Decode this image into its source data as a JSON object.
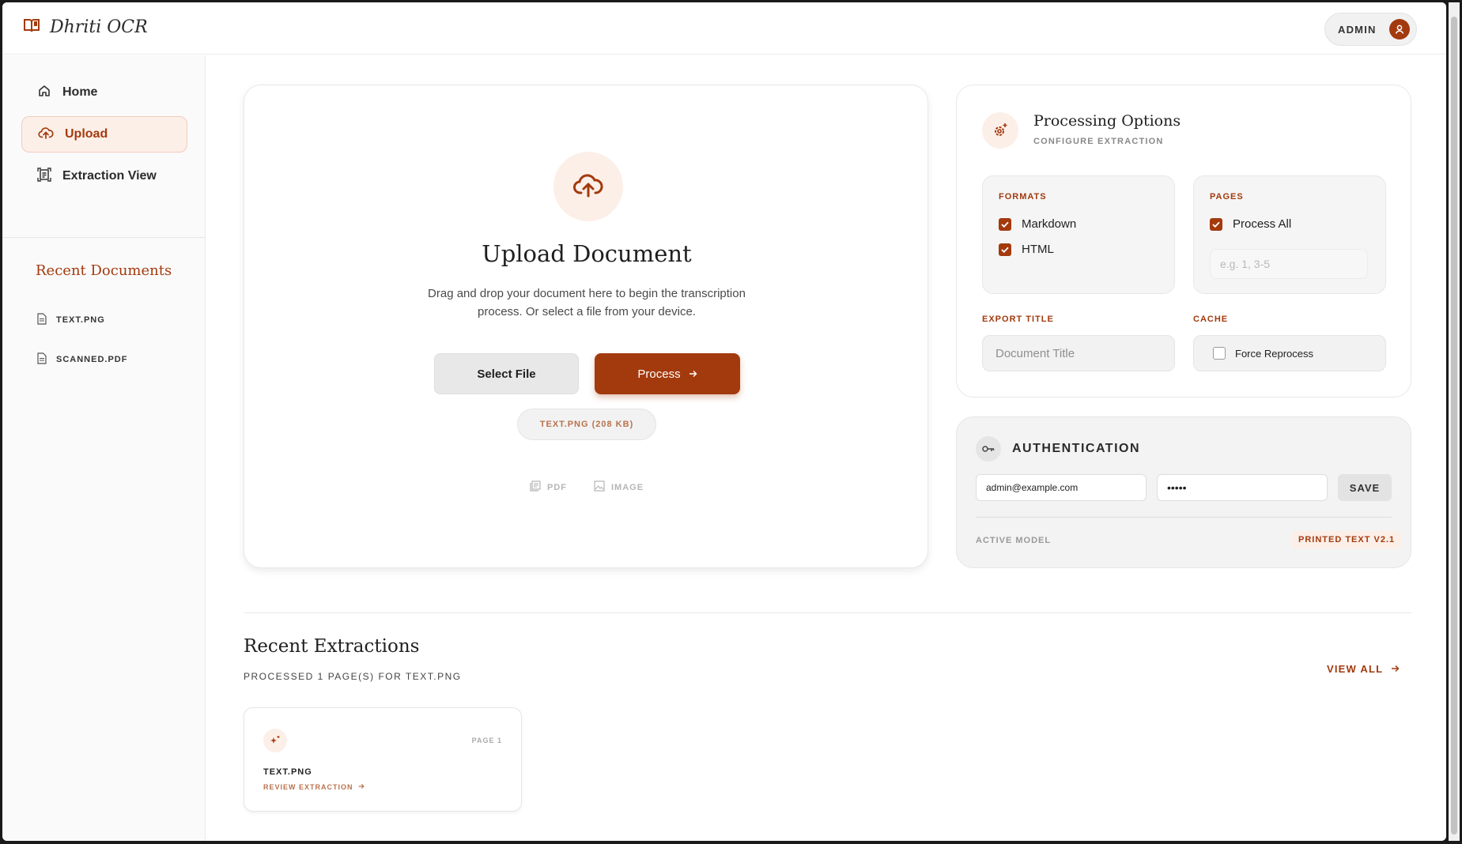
{
  "app": {
    "title": "Dhriti OCR"
  },
  "header": {
    "user_label": "ADMIN"
  },
  "sidebar": {
    "nav": [
      {
        "label": "Home",
        "icon": "home-icon"
      },
      {
        "label": "Upload",
        "icon": "cloud-upload-icon",
        "active": true
      },
      {
        "label": "Extraction View",
        "icon": "document-scan-icon"
      }
    ],
    "recent_title": "Recent Documents",
    "recent": [
      {
        "label": "TEXT.PNG",
        "icon": "file-icon"
      },
      {
        "label": "SCANNED.PDF",
        "icon": "file-icon"
      }
    ]
  },
  "upload": {
    "title": "Upload Document",
    "description": "Drag and drop your document here to begin the transcription process. Or select a file from your device.",
    "select_label": "Select File",
    "process_label": "Process",
    "selected_file": "TEXT.PNG (208 KB)",
    "types": [
      "PDF",
      "IMAGE"
    ]
  },
  "options": {
    "title": "Processing Options",
    "subtitle": "CONFIGURE EXTRACTION",
    "formats_label": "FORMATS",
    "formats": [
      {
        "label": "Markdown",
        "checked": true
      },
      {
        "label": "HTML",
        "checked": true
      }
    ],
    "pages_label": "PAGES",
    "process_all_label": "Process All",
    "pages_placeholder": "e.g. 1, 3-5",
    "export_title_label": "EXPORT TITLE",
    "export_title_placeholder": "Document Title",
    "cache_label": "CACHE",
    "force_reprocess_label": "Force Reprocess"
  },
  "auth": {
    "title": "AUTHENTICATION",
    "email_value": "admin@example.com",
    "password_value": "•••••",
    "save_label": "SAVE",
    "active_model_label": "ACTIVE MODEL",
    "active_model_value": "PRINTED TEXT V2.1"
  },
  "extractions": {
    "title": "Recent Extractions",
    "subtitle": "PROCESSED 1 PAGE(S) FOR TEXT.PNG",
    "view_all_label": "VIEW ALL",
    "items": [
      {
        "page": "PAGE 1",
        "name": "TEXT.PNG",
        "action": "REVIEW EXTRACTION"
      }
    ]
  },
  "colors": {
    "accent": "#a33a0e",
    "accent_soft": "#fcefe8"
  }
}
